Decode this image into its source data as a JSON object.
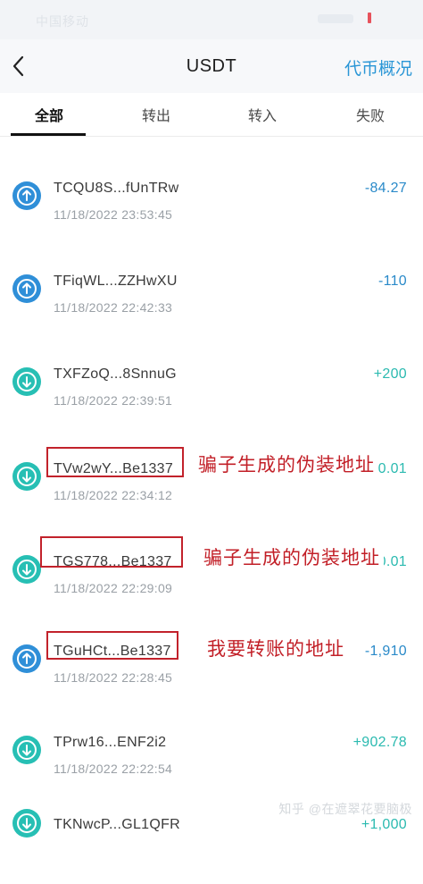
{
  "status_bar": {
    "left_text": "中国移动"
  },
  "header": {
    "title": "USDT",
    "right_link": "代币概况"
  },
  "tabs": [
    {
      "label": "全部",
      "active": true
    },
    {
      "label": "转出",
      "active": false
    },
    {
      "label": "转入",
      "active": false
    },
    {
      "label": "失败",
      "active": false
    }
  ],
  "transactions": [
    {
      "address": "TCQU8S...fUnTRw",
      "time": "11/18/2022 23:53:45",
      "amount": "-84.27",
      "direction": "out"
    },
    {
      "address": "TFiqWL...ZZHwXU",
      "time": "11/18/2022 22:42:33",
      "amount": "-110",
      "direction": "out"
    },
    {
      "address": "TXFZoQ...8SnnuG",
      "time": "11/18/2022 22:39:51",
      "amount": "+200",
      "direction": "in"
    },
    {
      "address": "TVw2wY...Be1337",
      "time": "11/18/2022 22:34:12",
      "amount": "+0.01",
      "direction": "in"
    },
    {
      "address": "TGS778...Be1337",
      "time": "11/18/2022 22:29:09",
      "amount": "+0.01",
      "direction": "in"
    },
    {
      "address": "TGuHCt...Be1337",
      "time": "11/18/2022 22:28:45",
      "amount": "-1,910",
      "direction": "out"
    },
    {
      "address": "TPrw16...ENF2i2",
      "time": "11/18/2022 22:22:54",
      "amount": "+902.78",
      "direction": "in"
    },
    {
      "address": "TKNwcP...GL1QFR",
      "time": "",
      "amount": "+1,000",
      "direction": "in"
    }
  ],
  "annotations": {
    "fake1": "骗子生成的伪装地址",
    "fake2": "骗子生成的伪装地址",
    "mine": "我要转账的地址"
  },
  "watermark": "知乎 @在遮翠花要脑极",
  "colors": {
    "link": "#2a96d6",
    "out_amount": "#2a8ac9",
    "in_amount": "#2bbab0",
    "out_icon": "#2f8fd8",
    "in_icon": "#27bfb4",
    "annotation_red": "#c21f27"
  },
  "icons": {
    "out": "arrow-up-circle-icon",
    "in": "arrow-down-circle-icon",
    "back": "chevron-left-icon"
  }
}
